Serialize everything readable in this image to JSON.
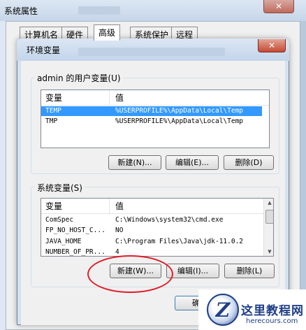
{
  "system_properties": {
    "title": "系统属性",
    "close_glyph": "✕",
    "tabs": [
      "计算机名",
      "硬件",
      "高级",
      "系统保护",
      "远程"
    ]
  },
  "env_dialog": {
    "title": "环境变量",
    "close_glyph": "✕",
    "user_group": {
      "label": "admin 的用户变量(U)",
      "col_variable": "变量",
      "col_value": "值",
      "rows": [
        {
          "name": "TEMP",
          "value": "%USERPROFILE%\\AppData\\Local\\Temp",
          "selected": true
        },
        {
          "name": "TMP",
          "value": "%USERPROFILE%\\AppData\\Local\\Temp",
          "selected": false
        }
      ],
      "buttons": {
        "new": "新建(N)...",
        "edit": "编辑(E)...",
        "delete": "删除(D)"
      }
    },
    "system_group": {
      "label": "系统变量(S)",
      "col_variable": "变量",
      "col_value": "值",
      "rows": [
        {
          "name": "ComSpec",
          "value": "C:\\Windows\\system32\\cmd.exe"
        },
        {
          "name": "FP_NO_HOST_C...",
          "value": "NO"
        },
        {
          "name": "JAVA_HOME",
          "value": "C:\\Program Files\\Java\\jdk-11.0.2"
        },
        {
          "name": "NUMBER_OF_PR...",
          "value": "4"
        }
      ],
      "buttons": {
        "new": "新建(W)...",
        "edit": "编辑(I)...",
        "delete": "删除(L)"
      }
    },
    "ok_button": "确定"
  },
  "watermark": {
    "logo_letter": "Z",
    "site_name": "这里教程网",
    "url": "herecours.com"
  }
}
